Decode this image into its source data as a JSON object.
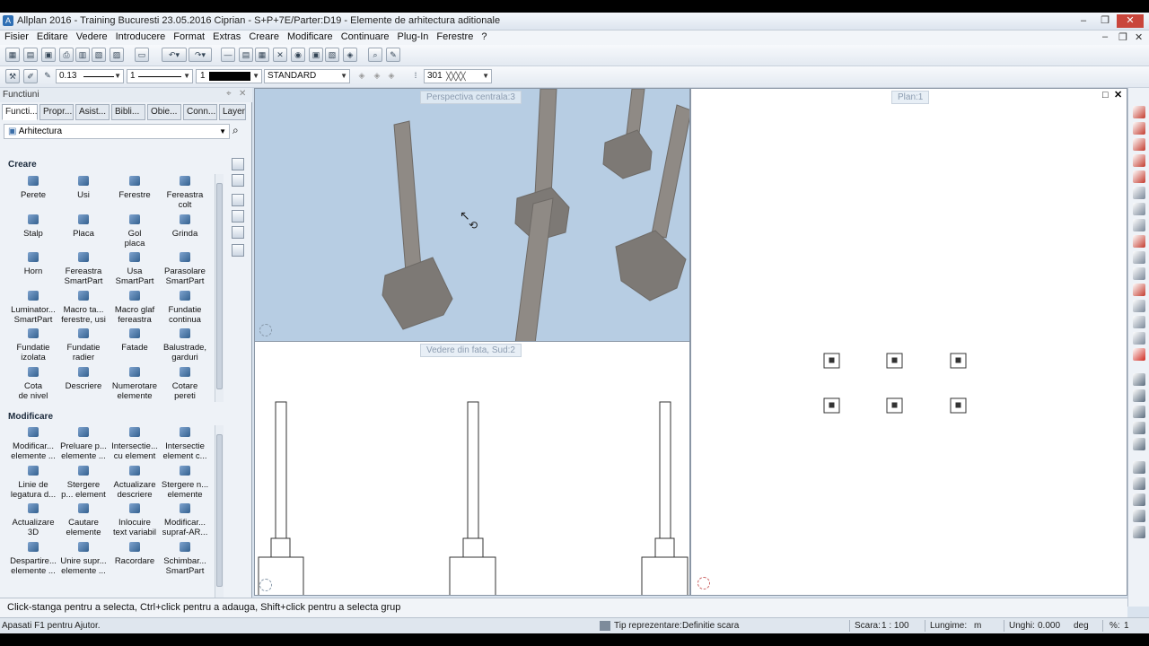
{
  "window": {
    "title": "Allplan 2016 - Training Bucuresti 23.05.2016 Ciprian - S+P+7E/Parter:D19 - Elemente de arhitectura aditionale",
    "controls": [
      "–",
      "❐",
      "✕"
    ]
  },
  "menu": {
    "items": [
      "Fisier",
      "Editare",
      "Vedere",
      "Introducere",
      "Format",
      "Extras",
      "Creare",
      "Modificare",
      "Continuare",
      "Plug-In",
      "Ferestre",
      "?"
    ],
    "system": [
      "–",
      "❐",
      "✕"
    ]
  },
  "format_bar": {
    "pen_value": "0.13",
    "line_value": "1",
    "color_value": "1",
    "layer_value": "STANDARD",
    "hatch_value": "301"
  },
  "palette": {
    "title": "Functiuni",
    "tabs": [
      "Functi...",
      "Propr...",
      "Asist...",
      "Bibli...",
      "Obie...",
      "Conn...",
      "Layer"
    ],
    "category": "Arhitectura",
    "sections": {
      "creare": {
        "title": "Creare",
        "items": [
          [
            "Perete",
            ""
          ],
          [
            "Usi",
            ""
          ],
          [
            "Ferestre",
            ""
          ],
          [
            "Fereastra",
            "colt"
          ],
          [
            "Stalp",
            ""
          ],
          [
            "Placa",
            ""
          ],
          [
            "Gol",
            "placa"
          ],
          [
            "Grinda",
            ""
          ],
          [
            "Horn",
            ""
          ],
          [
            "Fereastra",
            "SmartPart"
          ],
          [
            "Usa",
            "SmartPart"
          ],
          [
            "Parasolare",
            "SmartPart"
          ],
          [
            "Luminator...",
            "SmartPart"
          ],
          [
            "Macro ta...",
            "ferestre, usi"
          ],
          [
            "Macro glaf",
            "fereastra"
          ],
          [
            "Fundatie",
            "continua"
          ],
          [
            "Fundatie",
            "izolata"
          ],
          [
            "Fundatie",
            "radier"
          ],
          [
            "Fatade",
            ""
          ],
          [
            "Balustrade,",
            "garduri"
          ],
          [
            "Cota",
            "de nivel"
          ],
          [
            "Descriere",
            ""
          ],
          [
            "Numerotare",
            "elemente"
          ],
          [
            "Cotare",
            "pereti"
          ]
        ]
      },
      "modificare": {
        "title": "Modificare",
        "items": [
          [
            "Modificar...",
            "elemente ..."
          ],
          [
            "Preluare p...",
            "elemente ..."
          ],
          [
            "Intersectie...",
            "cu element"
          ],
          [
            "Intersectie",
            "element c..."
          ],
          [
            "Linie de",
            "legatura d..."
          ],
          [
            "Stergere",
            "p... element"
          ],
          [
            "Actualizare",
            "descriere"
          ],
          [
            "Stergere n...",
            "elemente"
          ],
          [
            "Actualizare",
            "3D"
          ],
          [
            "Cautare",
            "elemente"
          ],
          [
            "Inlocuire",
            "text variabil"
          ],
          [
            "Modificar...",
            "supraf-AR..."
          ],
          [
            "Despartire...",
            "elemente ..."
          ],
          [
            "Unire supr...",
            "elemente ..."
          ],
          [
            "Racordare",
            ""
          ],
          [
            "Schimbar...",
            "SmartPart"
          ]
        ]
      }
    }
  },
  "viewports": {
    "perspective_label": "Perspectiva centrala:3",
    "front_label": "Vedere din fata, Sud:2",
    "plan_label": "Plan:1"
  },
  "hint": "Click-stanga pentru a selecta, Ctrl+click pentru a adauga, Shift+click pentru a selecta grup",
  "status": {
    "help": "Apasati F1 pentru Ajutor.",
    "tip_label": "Tip reprezentare:",
    "tip_value": "Definitie scara",
    "scale_label": "Scara:",
    "scale_value": "1 : 100",
    "length_label": "Lungime:",
    "length_value": "m",
    "angle_label": "Unghi:",
    "angle_value": "0.000",
    "angle_unit": "deg",
    "percent_label": "%:",
    "percent_value": "1"
  }
}
